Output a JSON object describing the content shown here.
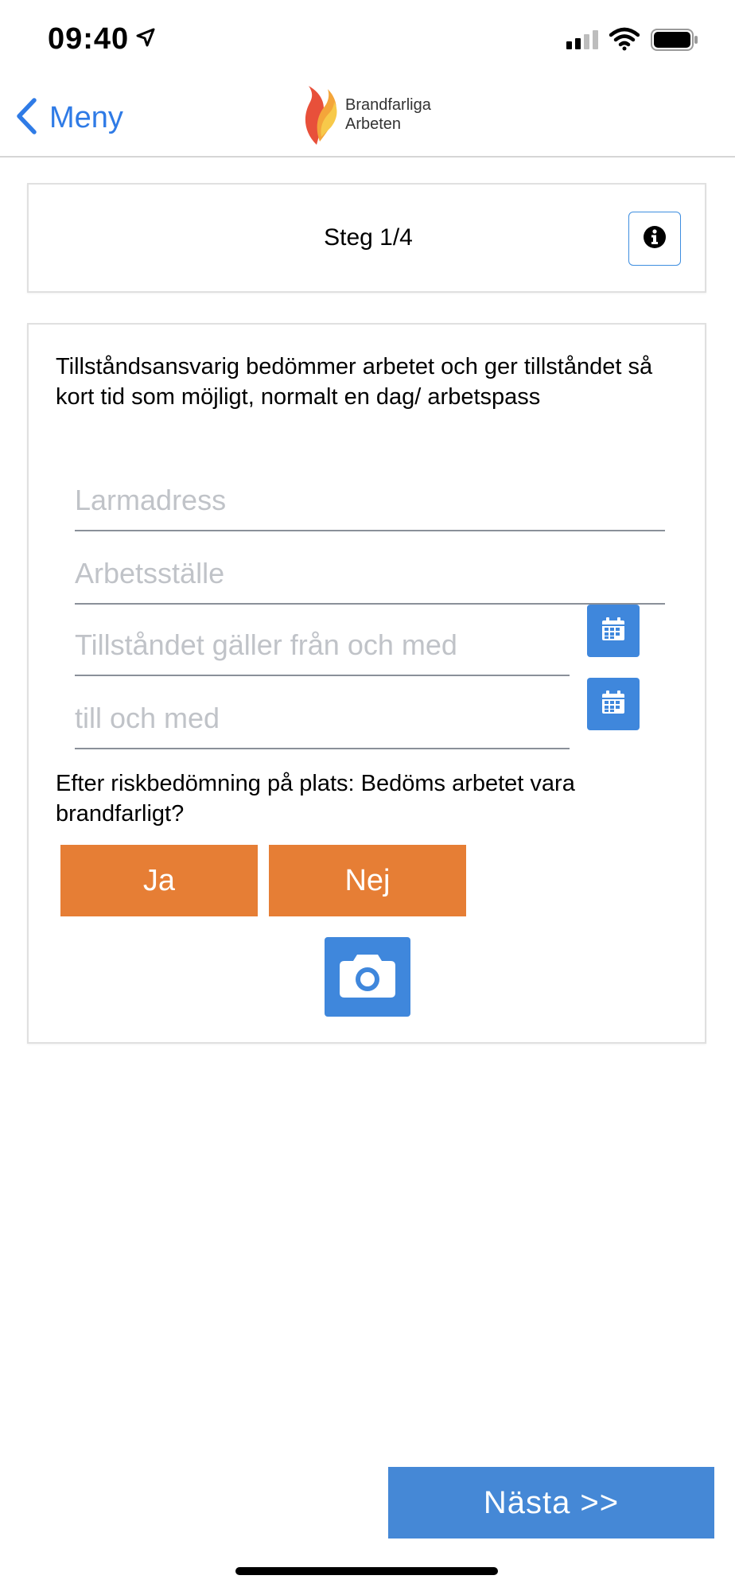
{
  "status_bar": {
    "time": "09:40",
    "icons": [
      "location-arrow-icon",
      "signal-icon",
      "wifi-icon",
      "battery-icon"
    ]
  },
  "nav": {
    "back_label": "Meny",
    "logo_text_line1": "Brandfarliga",
    "logo_text_line2": "Arbeten"
  },
  "step": {
    "label": "Steg 1/4"
  },
  "form": {
    "intro": "Tillståndsansvarig bedömmer arbetet och ger tillståndet så kort tid som möjligt, normalt en dag/ arbetspass",
    "address_placeholder": "Larmadress",
    "workplace_placeholder": "Arbetsställe",
    "valid_from_placeholder": "Tillståndet gäller från och med",
    "valid_to_placeholder": "till och med",
    "question": "Efter riskbedömning på plats: Bedöms arbetet vara brandfarligt?",
    "yes_label": "Ja",
    "no_label": "Nej"
  },
  "footer": {
    "next_label": "Nästa >>"
  },
  "colors": {
    "accent_blue": "#3f87dc",
    "link_blue": "#2f7be6",
    "orange": "#e67e35"
  }
}
